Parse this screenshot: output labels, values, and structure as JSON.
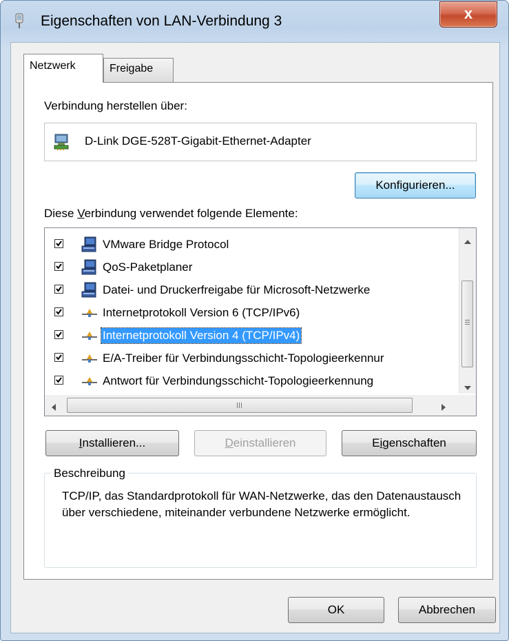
{
  "window": {
    "title": "Eigenschaften von LAN-Verbindung 3",
    "close_glyph": "x",
    "icon": "network-connection-icon"
  },
  "tabs": [
    {
      "label": "Netzwerk",
      "active": true
    },
    {
      "label": "Freigabe",
      "active": false
    }
  ],
  "connect_via": {
    "label": "Verbindung herstellen über:",
    "adapter_name": "D-Link DGE-528T-Gigabit-Ethernet-Adapter",
    "adapter_icon": "network-adapter-icon"
  },
  "configure_button": "Konfigurieren...",
  "elements": {
    "label_pre": "Diese ",
    "label_accel": "V",
    "label_post": "erbindung verwendet folgende Elemente:",
    "items": [
      {
        "label": "VMware Bridge Protocol",
        "checked": true,
        "icon": "network-client-icon",
        "selected": false
      },
      {
        "label": "QoS-Paketplaner",
        "checked": true,
        "icon": "network-client-icon",
        "selected": false
      },
      {
        "label": "Datei- und Druckerfreigabe für Microsoft-Netzwerke",
        "checked": true,
        "icon": "network-client-icon",
        "selected": false
      },
      {
        "label": "Internetprotokoll Version 6 (TCP/IPv6)",
        "checked": true,
        "icon": "protocol-icon",
        "selected": false
      },
      {
        "label": "Internetprotokoll Version 4 (TCP/IPv4)",
        "checked": true,
        "icon": "protocol-icon",
        "selected": true
      },
      {
        "label": "E/A-Treiber für Verbindungsschicht-Topologieerkennur",
        "checked": true,
        "icon": "protocol-icon",
        "selected": false
      },
      {
        "label": "Antwort für Verbindungsschicht-Topologieerkennung",
        "checked": true,
        "icon": "protocol-icon",
        "selected": false
      }
    ]
  },
  "buttons": {
    "install": {
      "accel": "I",
      "rest": "nstallieren..."
    },
    "uninstall": {
      "accel": "D",
      "rest": "einstallieren",
      "disabled": true
    },
    "properties": {
      "pre": "E",
      "accel": "i",
      "rest": "genschaften"
    }
  },
  "description": {
    "legend": "Beschreibung",
    "text": "TCP/IP, das Standardprotokoll für WAN-Netzwerke, das den Datenaustausch über verschiedene, miteinander verbundene Netzwerke ermöglicht."
  },
  "footer": {
    "ok": "OK",
    "cancel": "Abbrechen"
  },
  "colors": {
    "selection": "#3399ff",
    "close_button": "#c44a2d",
    "title_bar": "#bed3ea"
  }
}
